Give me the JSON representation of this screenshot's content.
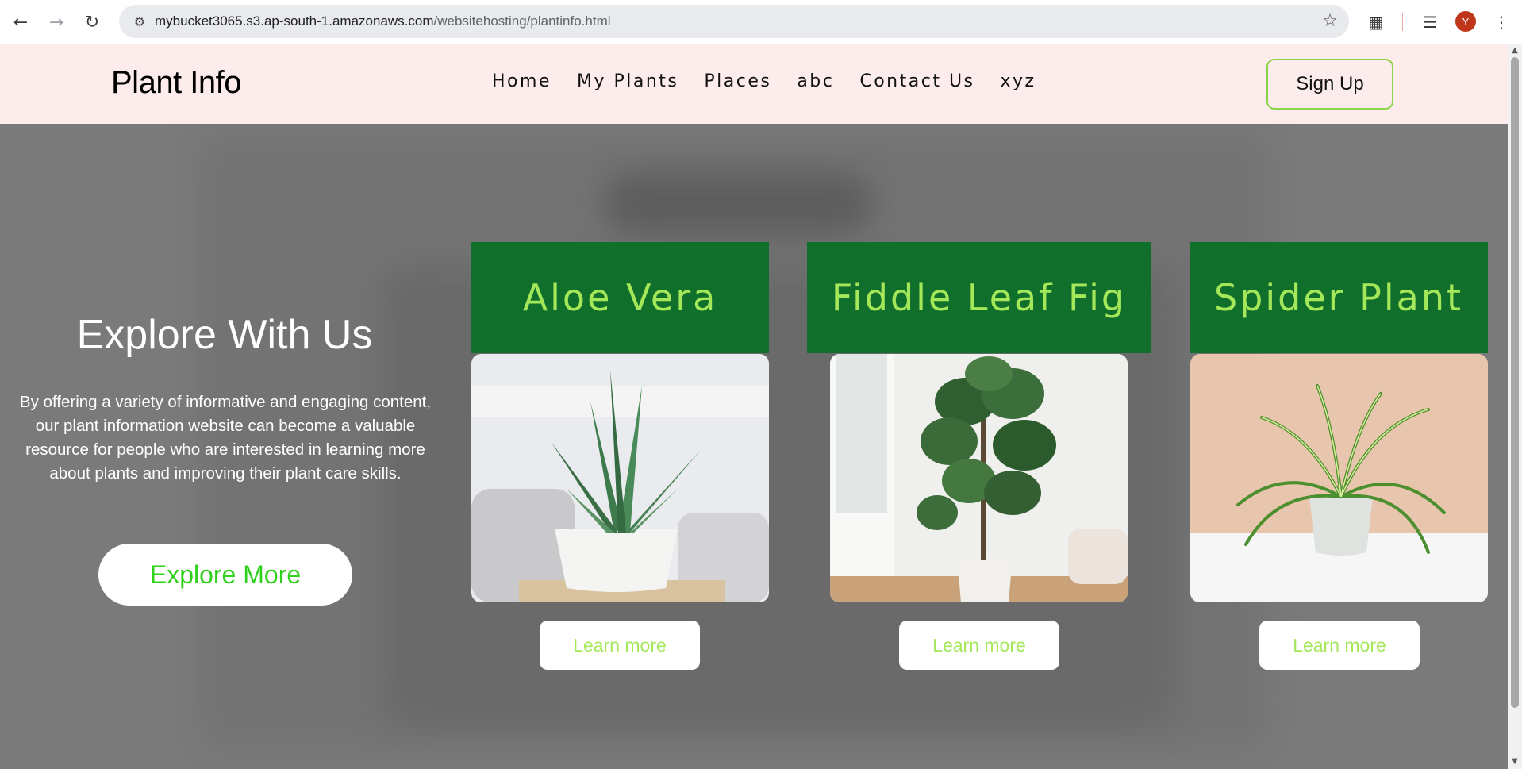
{
  "browser": {
    "url_host": "mybucket3065.s3.ap-south-1.amazonaws.com",
    "url_path": "/websitehosting/plantinfo.html",
    "profile_initial": "Y",
    "icons": [
      "back-icon",
      "forward-icon",
      "reload-icon",
      "site-info-icon",
      "bookmark-star-icon",
      "extensions-icon",
      "media-control-icon",
      "menu-icon"
    ]
  },
  "header": {
    "brand": "Plant Info",
    "nav": [
      "Home",
      "My Plants",
      "Places",
      "abc",
      "Contact Us",
      "xyz"
    ],
    "signup_label": "Sign Up"
  },
  "hero": {
    "title": "Explore With Us",
    "text": "By offering a variety of informative and engaging content, our plant information website can become a valuable resource for people who are interested in learning more about plants and improving their plant care skills.",
    "button_label": "Explore More"
  },
  "cards": [
    {
      "title": "Aloe Vera",
      "button_label": "Learn more"
    },
    {
      "title": "Fiddle Leaf Fig",
      "button_label": "Learn more"
    },
    {
      "title": "Spider Plant",
      "button_label": "Learn more"
    }
  ],
  "colors": {
    "header_bg": "#fdecec",
    "card_title_bg": "#116f2c",
    "card_title_text": "#a4e85a",
    "explore_button_text": "#2fd11b",
    "signup_border": "#8dd44a",
    "hero_bg": "#7a7a7a"
  }
}
